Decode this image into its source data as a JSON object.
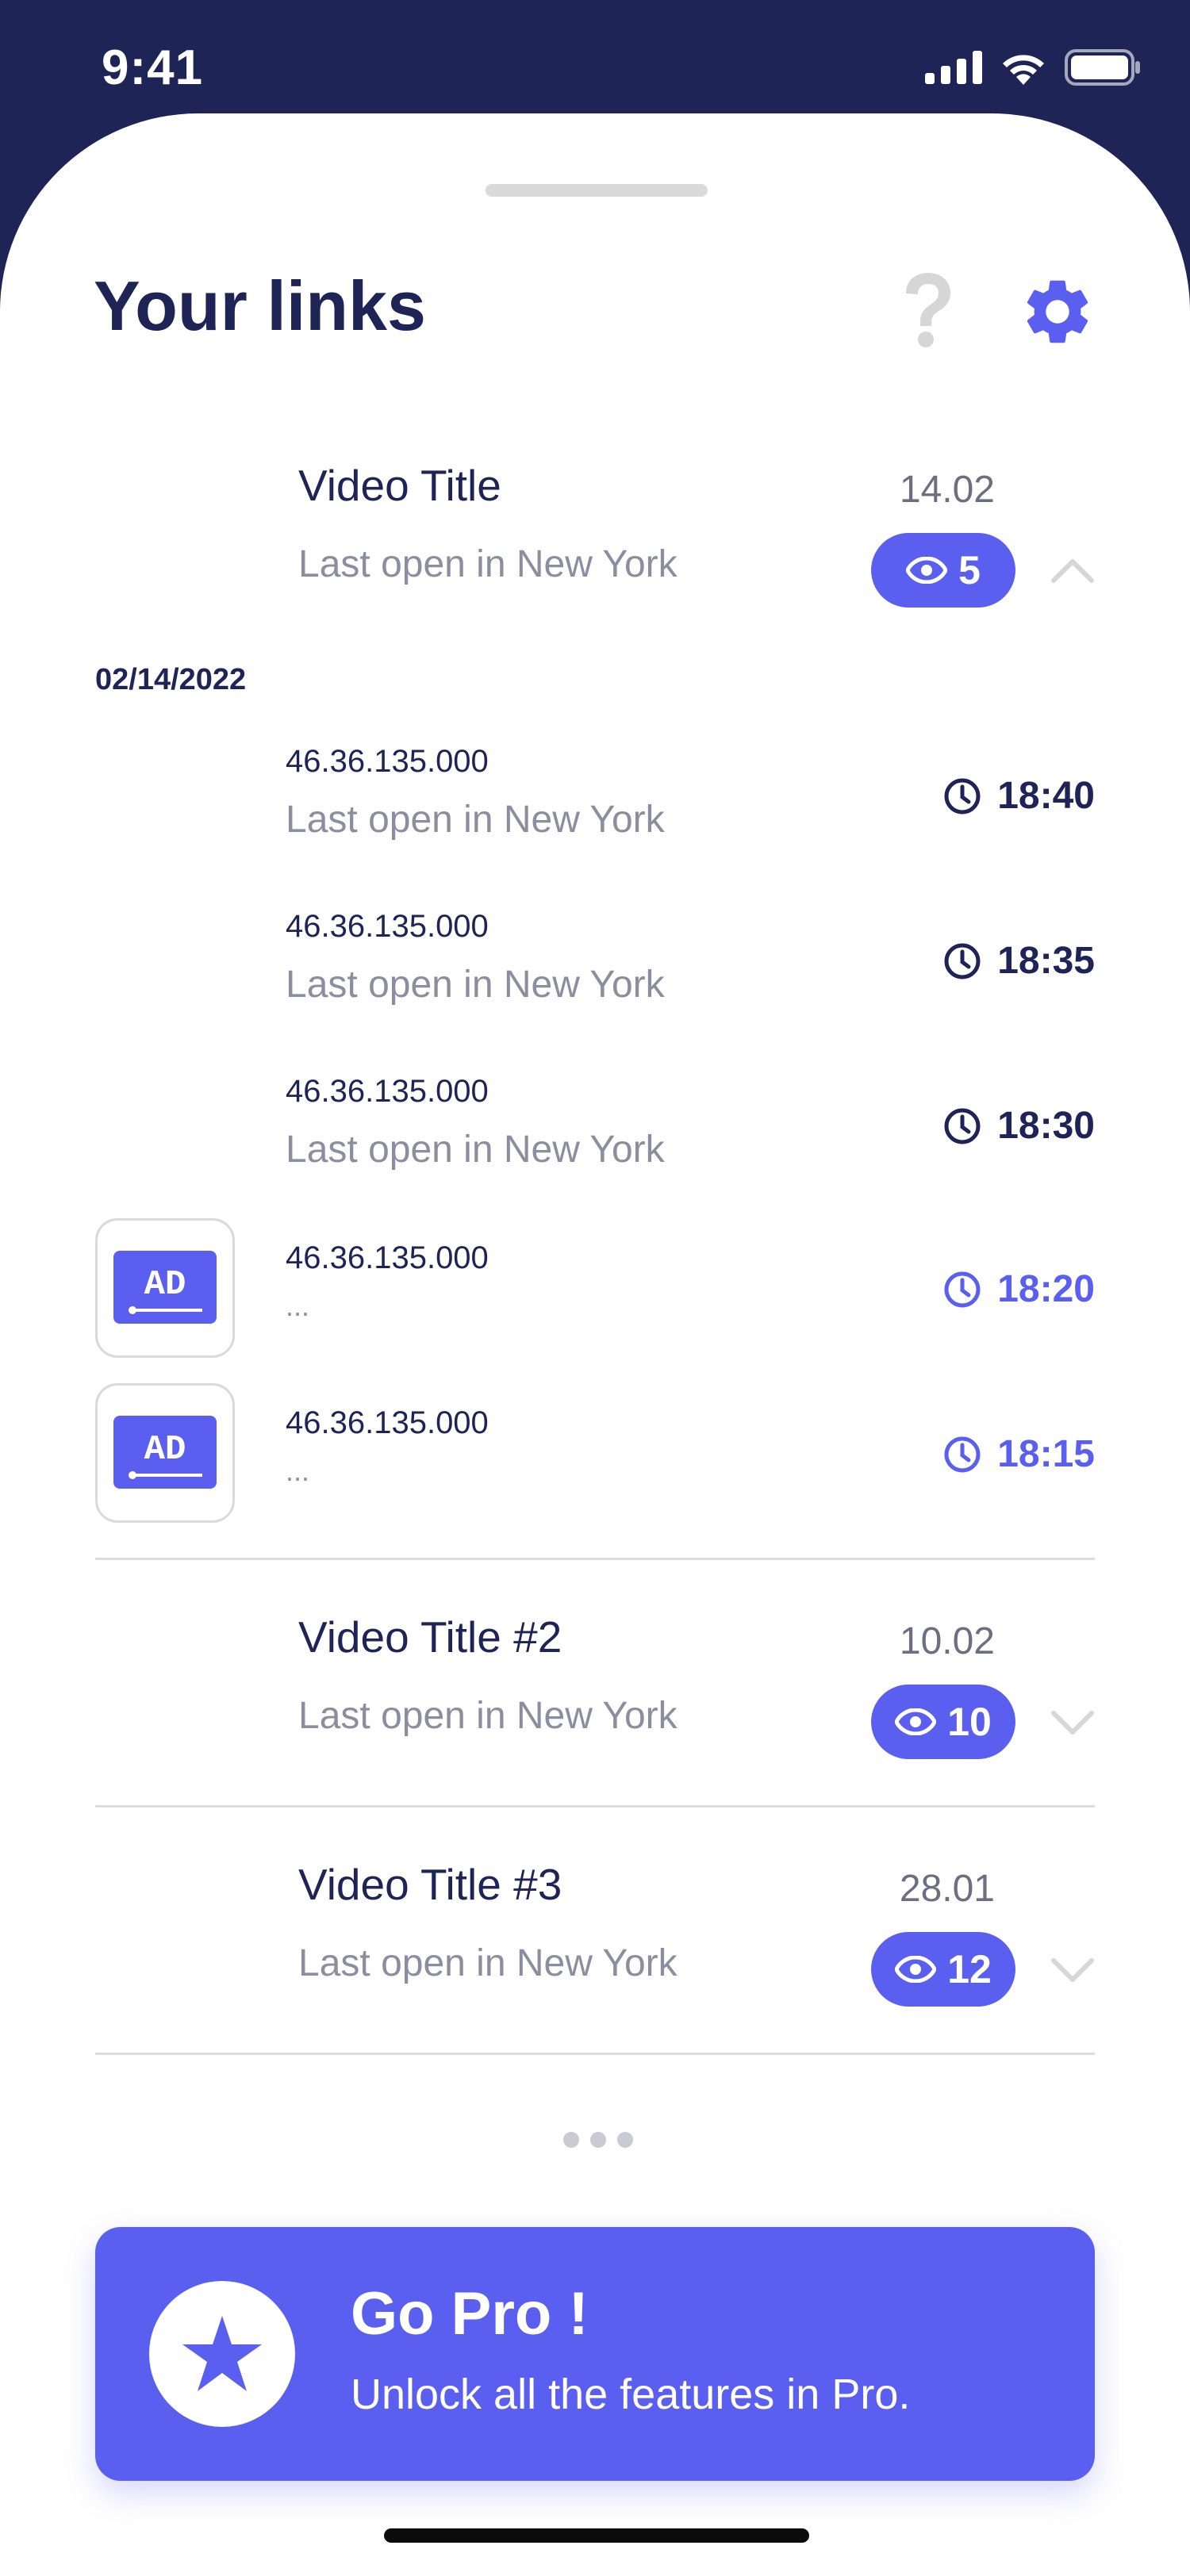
{
  "status": {
    "time": "9:41"
  },
  "header": {
    "title": "Your links"
  },
  "links": [
    {
      "title": "Video Title",
      "subtitle": "Last open in New York",
      "date": "14.02",
      "views": "5"
    },
    {
      "title": "Video Title #2",
      "subtitle": "Last open in New York",
      "date": "10.02",
      "views": "10"
    },
    {
      "title": "Video Title #3",
      "subtitle": "Last open in New York",
      "date": "28.01",
      "views": "12"
    }
  ],
  "expanded": {
    "date_header": "02/14/2022",
    "visits": [
      {
        "ip": "46.36.135.000",
        "location": "Last open in New York",
        "time": "18:40",
        "ad": false
      },
      {
        "ip": "46.36.135.000",
        "location": "Last open in New York",
        "time": "18:35",
        "ad": false
      },
      {
        "ip": "46.36.135.000",
        "location": "Last open in New York",
        "time": "18:30",
        "ad": false
      },
      {
        "ip": "46.36.135.000",
        "location": "...",
        "time": "18:20",
        "ad": true,
        "badge": "AD"
      },
      {
        "ip": "46.36.135.000",
        "location": "...",
        "time": "18:15",
        "ad": true,
        "badge": "AD"
      }
    ]
  },
  "promo": {
    "title": "Go Pro !",
    "subtitle": "Unlock all the features in Pro."
  },
  "colors": {
    "navy": "#1F2456",
    "accent": "#5B5FEF",
    "muted": "#8A8E9E",
    "help": "#D6D6D6"
  },
  "icons": [
    "signal-icon",
    "wifi-icon",
    "battery-icon",
    "help-icon",
    "gear-icon",
    "eye-icon",
    "chevron-up-icon",
    "chevron-down-icon",
    "clock-icon",
    "ad-icon",
    "star-icon"
  ]
}
